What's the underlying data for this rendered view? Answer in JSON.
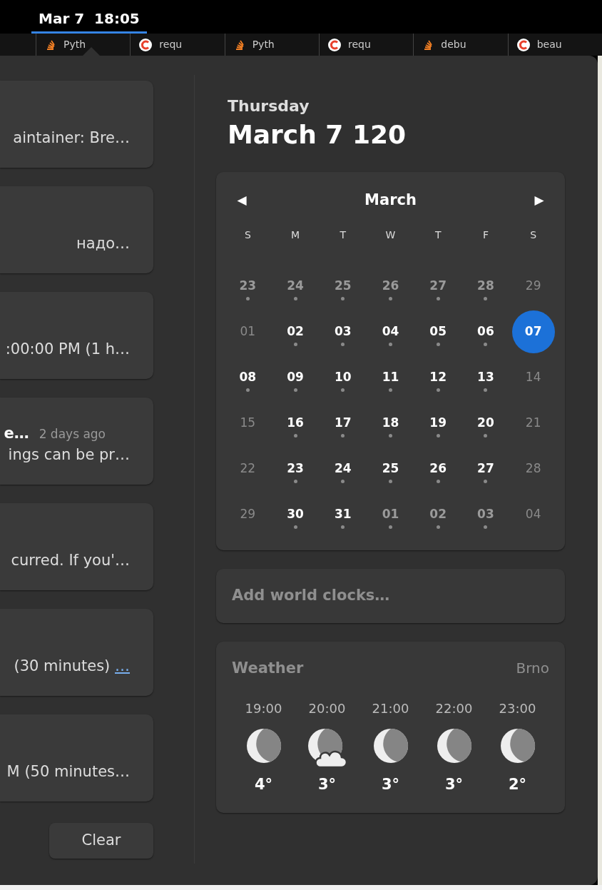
{
  "top_bar": {
    "clock": "Mar 7  18:05",
    "clock_active": true
  },
  "browser_tabs": [
    {
      "kind": "stack",
      "title": "Pyth"
    },
    {
      "kind": "ring",
      "title": "requ"
    },
    {
      "kind": "stack",
      "title": "Pyth"
    },
    {
      "kind": "ring",
      "title": "requ"
    },
    {
      "kind": "stack",
      "title": "debu"
    },
    {
      "kind": "ring",
      "title": "beau"
    }
  ],
  "notifications": [
    {
      "body": "aintainer: Bre…"
    },
    {
      "body": "надо…"
    },
    {
      "body": ":00:00 PM (1 h…"
    },
    {
      "title": "e…",
      "time": "2 days ago",
      "body": "ings can be pr…"
    },
    {
      "body": "curred. If you'…"
    },
    {
      "body": "(30 minutes)",
      "link": "…"
    },
    {
      "body": "M (50 minutes…"
    }
  ],
  "clear_button": "Clear",
  "date_header": {
    "weekday": "Thursday",
    "date": "March 7 120"
  },
  "calendar": {
    "month": "March",
    "prev": "◀",
    "next": "▶",
    "weekdays": [
      "S",
      "M",
      "T",
      "W",
      "T",
      "F",
      "S"
    ],
    "weeks": [
      [
        {
          "day": "23",
          "kind": "other_month",
          "events": true,
          "selected": false
        },
        {
          "day": "24",
          "kind": "other_month",
          "events": true,
          "selected": false
        },
        {
          "day": "25",
          "kind": "other_month",
          "events": true,
          "selected": false
        },
        {
          "day": "26",
          "kind": "other_month",
          "events": true,
          "selected": false
        },
        {
          "day": "27",
          "kind": "other_month",
          "events": true,
          "selected": false
        },
        {
          "day": "28",
          "kind": "other_month",
          "events": true,
          "selected": false
        },
        {
          "day": "29",
          "kind": "weekend",
          "events": false,
          "selected": false
        }
      ],
      [
        {
          "day": "01",
          "kind": "weekend",
          "events": false,
          "selected": false
        },
        {
          "day": "02",
          "kind": "weekday",
          "events": true,
          "selected": false
        },
        {
          "day": "03",
          "kind": "weekday",
          "events": true,
          "selected": false
        },
        {
          "day": "04",
          "kind": "weekday",
          "events": true,
          "selected": false
        },
        {
          "day": "05",
          "kind": "weekday",
          "events": true,
          "selected": false
        },
        {
          "day": "06",
          "kind": "weekday",
          "events": true,
          "selected": false
        },
        {
          "day": "07",
          "kind": "weekend",
          "events": false,
          "selected": true
        }
      ],
      [
        {
          "day": "08",
          "kind": "weekday",
          "events": true,
          "selected": false
        },
        {
          "day": "09",
          "kind": "weekday",
          "events": true,
          "selected": false
        },
        {
          "day": "10",
          "kind": "weekday",
          "events": true,
          "selected": false
        },
        {
          "day": "11",
          "kind": "weekday",
          "events": true,
          "selected": false
        },
        {
          "day": "12",
          "kind": "weekday",
          "events": true,
          "selected": false
        },
        {
          "day": "13",
          "kind": "weekday",
          "events": true,
          "selected": false
        },
        {
          "day": "14",
          "kind": "weekend",
          "events": false,
          "selected": false
        }
      ],
      [
        {
          "day": "15",
          "kind": "weekend",
          "events": false,
          "selected": false
        },
        {
          "day": "16",
          "kind": "weekday",
          "events": true,
          "selected": false
        },
        {
          "day": "17",
          "kind": "weekday",
          "events": true,
          "selected": false
        },
        {
          "day": "18",
          "kind": "weekday",
          "events": true,
          "selected": false
        },
        {
          "day": "19",
          "kind": "weekday",
          "events": true,
          "selected": false
        },
        {
          "day": "20",
          "kind": "weekday",
          "events": true,
          "selected": false
        },
        {
          "day": "21",
          "kind": "weekend",
          "events": false,
          "selected": false
        }
      ],
      [
        {
          "day": "22",
          "kind": "weekend",
          "events": false,
          "selected": false
        },
        {
          "day": "23",
          "kind": "weekday",
          "events": true,
          "selected": false
        },
        {
          "day": "24",
          "kind": "weekday",
          "events": true,
          "selected": false
        },
        {
          "day": "25",
          "kind": "weekday",
          "events": true,
          "selected": false
        },
        {
          "day": "26",
          "kind": "weekday",
          "events": true,
          "selected": false
        },
        {
          "day": "27",
          "kind": "weekday",
          "events": true,
          "selected": false
        },
        {
          "day": "28",
          "kind": "weekend",
          "events": false,
          "selected": false
        }
      ],
      [
        {
          "day": "29",
          "kind": "weekend",
          "events": false,
          "selected": false
        },
        {
          "day": "30",
          "kind": "weekday",
          "events": true,
          "selected": false
        },
        {
          "day": "31",
          "kind": "weekday",
          "events": true,
          "selected": false
        },
        {
          "day": "01",
          "kind": "other_month",
          "events": true,
          "selected": false
        },
        {
          "day": "02",
          "kind": "other_month",
          "events": true,
          "selected": false
        },
        {
          "day": "03",
          "kind": "other_month",
          "events": true,
          "selected": false
        },
        {
          "day": "04",
          "kind": "weekend",
          "events": false,
          "selected": false
        }
      ]
    ]
  },
  "world_clocks": {
    "label": "Add world clocks…"
  },
  "weather": {
    "title": "Weather",
    "location": "Brno",
    "forecast": [
      {
        "time": "19:00",
        "kind": "clear_night",
        "temp": "4°"
      },
      {
        "time": "20:00",
        "kind": "cloudy_night",
        "temp": "3°"
      },
      {
        "time": "21:00",
        "kind": "clear_night",
        "temp": "3°"
      },
      {
        "time": "22:00",
        "kind": "clear_night",
        "temp": "3°"
      },
      {
        "time": "23:00",
        "kind": "clear_night",
        "temp": "2°"
      }
    ]
  }
}
